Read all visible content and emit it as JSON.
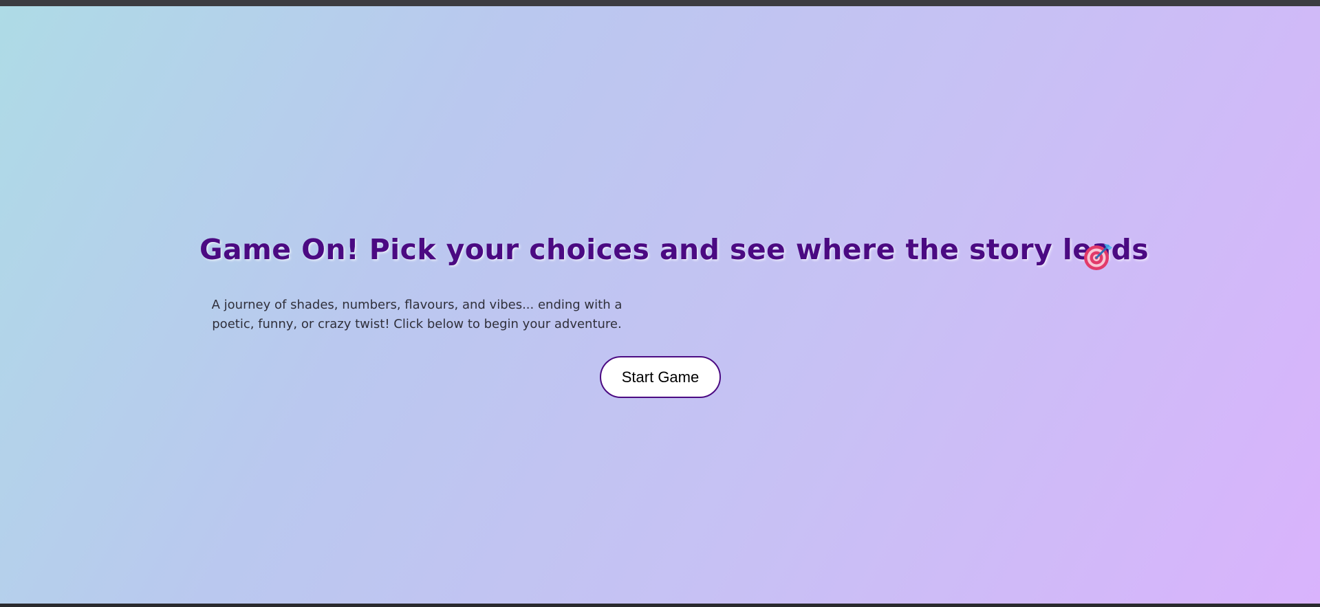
{
  "page": {
    "title": "Game On! Pick your choices and see where the story leads",
    "title_icon": "direct-hit-target-icon",
    "description": "A journey of shades, numbers, flavours, and vibes... ending with a poetic, funny, or crazy twist! Click below to begin your adventure.",
    "start_button_label": "Start Game"
  },
  "colors": {
    "title": "#4b0a82",
    "button_border": "#4b0a82",
    "button_background": "#ffffff",
    "background_gradient_start": "#aedbe6",
    "background_gradient_end": "#d9b3fc"
  }
}
